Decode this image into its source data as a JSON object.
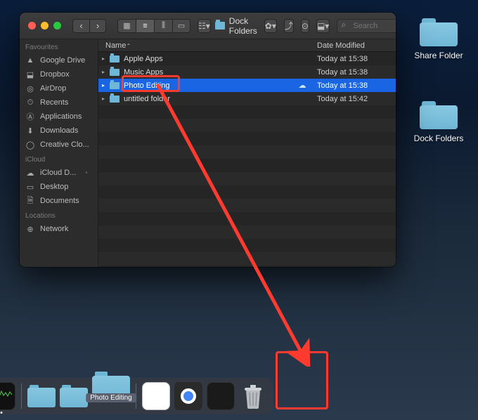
{
  "desktop": {
    "items": [
      {
        "label": "Share Folder"
      },
      {
        "label": "Dock Folders"
      }
    ]
  },
  "finder": {
    "title": "Dock Folders",
    "search_placeholder": "Search",
    "columns": {
      "name": "Name",
      "date": "Date Modified"
    },
    "sidebar": {
      "favourites_hdr": "Favourites",
      "icloud_hdr": "iCloud",
      "locations_hdr": "Locations",
      "favourites": [
        {
          "icon": "▲",
          "label": "Google Drive"
        },
        {
          "icon": "⬓",
          "label": "Dropbox"
        },
        {
          "icon": "◎",
          "label": "AirDrop"
        },
        {
          "icon": "⏱",
          "label": "Recents"
        },
        {
          "icon": "Ⓐ",
          "label": "Applications"
        },
        {
          "icon": "⬇",
          "label": "Downloads"
        },
        {
          "icon": "◯",
          "label": "Creative Clo..."
        }
      ],
      "icloud": [
        {
          "icon": "☁",
          "label": "iCloud D..."
        },
        {
          "icon": "▭",
          "label": "Desktop"
        },
        {
          "icon": "🗎",
          "label": "Documents"
        }
      ],
      "locations": [
        {
          "icon": "⊕",
          "label": "Network"
        }
      ]
    },
    "rows": [
      {
        "name": "Apple Apps",
        "date": "Today at 15:38",
        "selected": false,
        "cloud": false
      },
      {
        "name": "Music Apps",
        "date": "Today at 15:38",
        "selected": false,
        "cloud": false
      },
      {
        "name": "Photo Editing",
        "date": "Today at 15:38",
        "selected": true,
        "cloud": true
      },
      {
        "name": "untitled folder",
        "date": "Today at 15:42",
        "selected": false,
        "cloud": false
      }
    ]
  },
  "dock": {
    "drag_label": "Photo Editing",
    "icons": {
      "affinity": "affinity-photo",
      "spotify": "spotify",
      "snagit": "snagit",
      "terminal": "terminal",
      "monitor": "activity-monitor",
      "downloads": "downloads-folder",
      "windows": "windows-folder",
      "photo": "photo-editing-drop",
      "docs": "docs-stack",
      "chrome": "chrome-window",
      "affinity2": "affinity-window",
      "trash": "trash"
    }
  }
}
